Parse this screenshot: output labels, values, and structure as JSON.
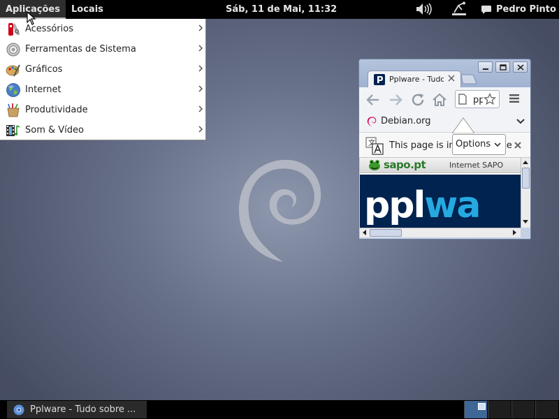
{
  "top_panel": {
    "applications": "Aplicações",
    "places": "Locais",
    "clock": "Sáb, 11 de Mai, 11:32",
    "user": "Pedro Pinto"
  },
  "apps_menu": {
    "items": [
      {
        "label": "Acessórios",
        "icon": "accessories-icon"
      },
      {
        "label": "Ferramentas de Sistema",
        "icon": "system-tools-icon"
      },
      {
        "label": "Gráficos",
        "icon": "graphics-icon"
      },
      {
        "label": "Internet",
        "icon": "internet-icon"
      },
      {
        "label": "Produtividade",
        "icon": "office-icon"
      },
      {
        "label": "Som & Vídeo",
        "icon": "multimedia-icon"
      }
    ]
  },
  "browser": {
    "tab_title": "Pplware - Tudo",
    "address": "pplware",
    "bookmark": "Debian.org",
    "infobar_text": "This page is in",
    "infobar_tail": "se",
    "options_label": "Options",
    "sapo_logo_text": "sapo.pt",
    "sapo_right": "Internet SAPO",
    "banner_part1": "ppl",
    "banner_part2": "wa"
  },
  "taskbar": {
    "task_label": "Pplware - Tudo sobre ..."
  },
  "colors": {
    "panel": "#000000",
    "accent_blue": "#3f6796",
    "debian_red": "#d70751",
    "banner_navy": "#00234f",
    "banner_cyan": "#25a9e0"
  }
}
